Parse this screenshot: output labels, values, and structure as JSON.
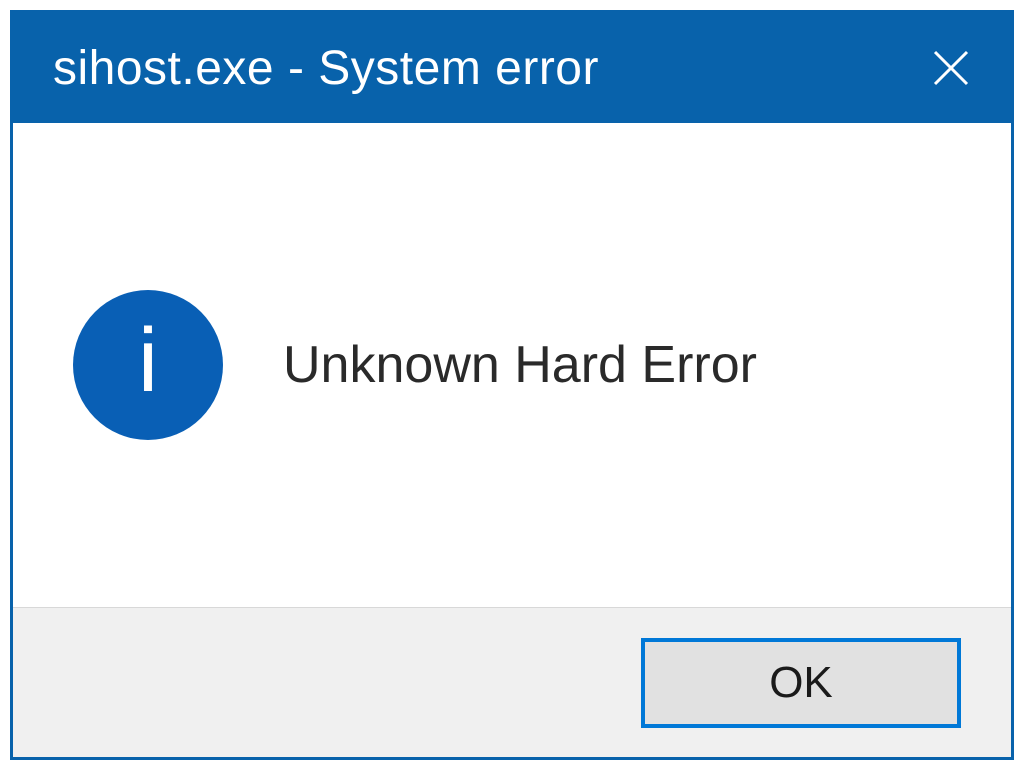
{
  "dialog": {
    "title": "sihost.exe - System error",
    "message": "Unknown Hard Error",
    "icon": "info-icon",
    "buttons": {
      "ok_label": "OK"
    }
  }
}
